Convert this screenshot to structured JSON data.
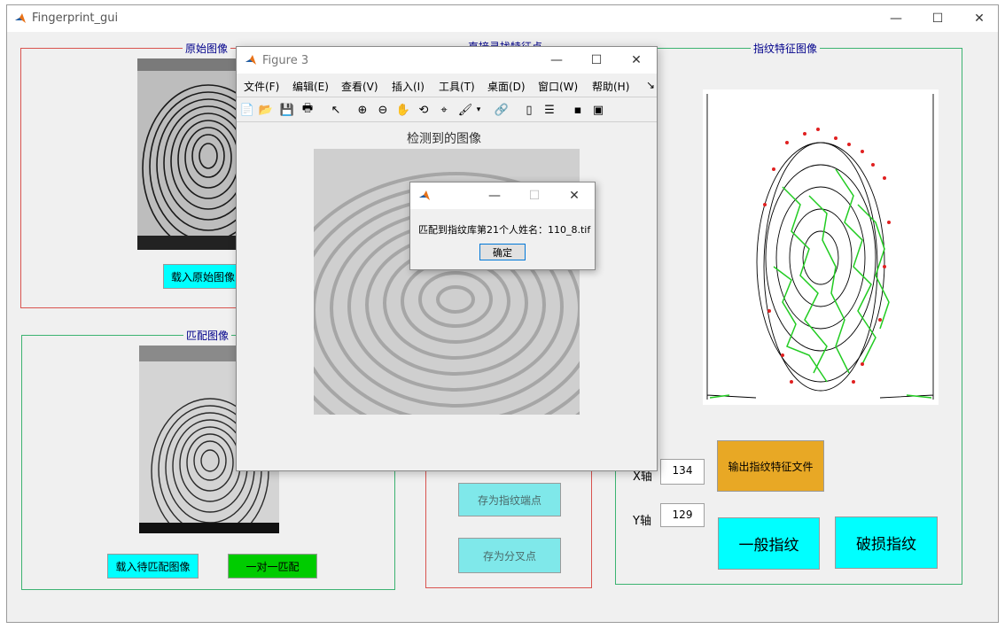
{
  "main_window": {
    "title": "Fingerprint_gui",
    "controls": {
      "minimize": "—",
      "maximize": "☐",
      "close": "✕"
    }
  },
  "panels": {
    "original": {
      "title": "原始图像",
      "load_button": "载入原始图像"
    },
    "match": {
      "title": "匹配图像",
      "load_button": "载入待匹配图像",
      "match_button": "一对一匹配"
    },
    "direct": {
      "title": "直接寻找特征点",
      "save_endpoints": "存为指纹端点",
      "save_bifurcations": "存为分叉点"
    },
    "feature": {
      "title": "指纹特征图像",
      "x_label": "X轴",
      "x_value": "134",
      "y_label": "Y轴",
      "y_value": "129",
      "export_button": "输出指纹特征文件",
      "normal_button": "一般指纹",
      "damaged_button": "破损指纹"
    }
  },
  "figure": {
    "title": "Figure 3",
    "menu": [
      "文件(F)",
      "编辑(E)",
      "查看(V)",
      "插入(I)",
      "工具(T)",
      "桌面(D)",
      "窗口(W)",
      "帮助(H)"
    ],
    "menu_more": "↘",
    "toolbar_icons": [
      "new-icon",
      "open-icon",
      "save-icon",
      "print-icon",
      "pointer-icon",
      "zoom-in-icon",
      "zoom-out-icon",
      "pan-icon",
      "rotate-icon",
      "data-cursor-icon",
      "brush-icon",
      "brush-dropdown-icon",
      "link-icon",
      "colorbar-icon",
      "legend-icon",
      "hide-plot-tools-icon",
      "show-plot-tools-icon"
    ],
    "axes_title": "检测到的图像"
  },
  "dialog": {
    "message": "匹配到指纹库第21个人姓名：110_8.tif",
    "ok_button": "确定"
  },
  "colors": {
    "cyan": "#00ffff",
    "green": "#00cc00",
    "orange": "#e8a825",
    "red_border": "#d9534f",
    "green_border": "#3cb371"
  }
}
